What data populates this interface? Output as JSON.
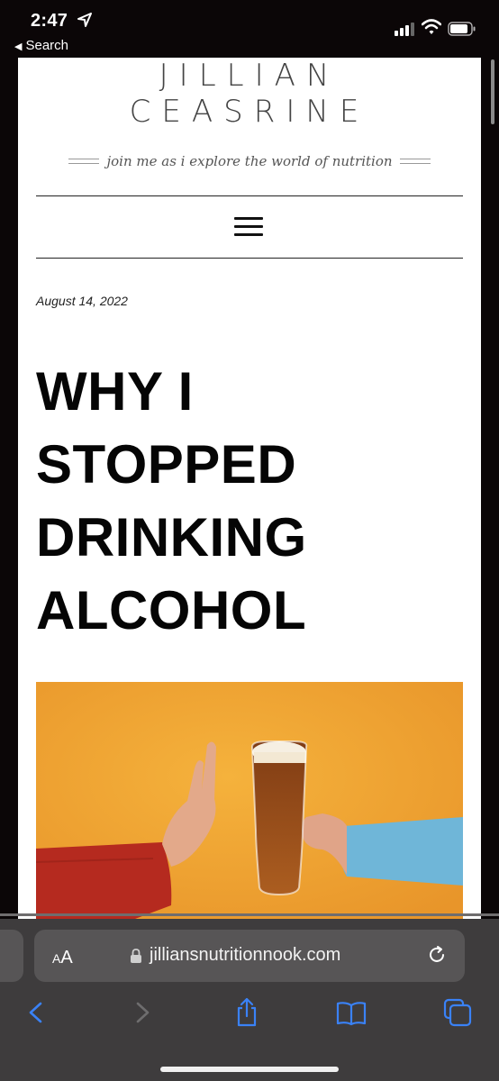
{
  "status_bar": {
    "time": "2:47",
    "back_label": "Search",
    "icons": [
      "location-arrow-icon",
      "cellular-signal-icon",
      "wifi-icon",
      "battery-icon"
    ]
  },
  "site": {
    "title_line1": "JILLIAN",
    "title_line2": "CEASRINE",
    "tagline": "join me as i explore the world of nutrition"
  },
  "post": {
    "date": "August 14, 2022",
    "title": "WHY I STOPPED DRINKING ALCOHOL"
  },
  "browser": {
    "text_size_label_big": "A",
    "text_size_label_small": "A",
    "url": "jilliansnutritionnook.com",
    "toolbar": [
      "back-icon",
      "forward-icon",
      "share-icon",
      "bookmarks-icon",
      "tabs-icon"
    ]
  },
  "colors": {
    "hero_background": "#f0a02e",
    "chrome_background": "#3e3c3d",
    "accent_blue": "#3a82f7"
  }
}
